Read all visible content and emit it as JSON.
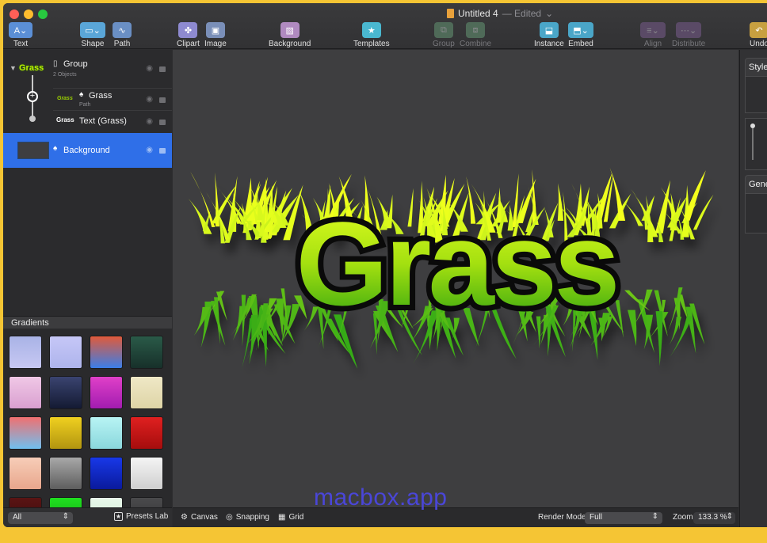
{
  "window": {
    "title": "Untitled 4",
    "status": "— Edited"
  },
  "toolbar": {
    "text": "Text",
    "shape": "Shape",
    "path": "Path",
    "clipart": "Clipart",
    "image": "Image",
    "background": "Background",
    "templates": "Templates",
    "group": "Group",
    "combine": "Combine",
    "instance": "Instance",
    "embed": "Embed",
    "align": "Align",
    "distribute": "Distribute",
    "undo": "Undo"
  },
  "layers": [
    {
      "name": "Group",
      "sub": "2 Objects",
      "thumb": "Grass"
    },
    {
      "name": "Grass",
      "sub": "Path",
      "thumb": "Grass"
    },
    {
      "name": "Text (Grass)",
      "thumb": "Grass"
    },
    {
      "name": "Background"
    }
  ],
  "gradients": {
    "title": "Gradients",
    "swatches": [
      [
        "#a9b3e6",
        "#c7c8f3"
      ],
      [
        "#c6c7f7",
        "#aeb4ec"
      ],
      [
        "#e05a3a",
        "#3b7ee8"
      ],
      [
        "#2a5a48",
        "#17302a"
      ],
      [
        "#f0c8e6",
        "#d99fd0"
      ],
      [
        "#3a4470",
        "#141a33"
      ],
      [
        "#e040c8",
        "#a21cb0"
      ],
      [
        "#efe8c6",
        "#ded4a6"
      ],
      [
        "#f07070",
        "#70c0f0"
      ],
      [
        "#f0d020",
        "#b29510"
      ],
      [
        "#b8f4f4",
        "#8ad7dc"
      ],
      [
        "#e02020",
        "#a50d0d"
      ],
      [
        "#f7cdb8",
        "#e8a68c"
      ],
      [
        "#a8a8a8",
        "#5e5e5e"
      ],
      [
        "#1838e8",
        "#0a1a9c"
      ],
      [
        "#f4f4f4",
        "#cfcfcf"
      ],
      [
        "#5a1414",
        "#3a0a0a"
      ],
      [
        "#20e020",
        "#12a012"
      ],
      [
        "#e8f8ea",
        "#cfe8d3"
      ],
      [
        "#4a4a4c",
        "#333335"
      ]
    ],
    "filter": "All",
    "presets": "Presets Lab"
  },
  "bottom_bar": {
    "canvas": "Canvas",
    "snapping": "Snapping",
    "grid": "Grid",
    "render_label": "Render Mode",
    "render_value": "Full",
    "zoom_label": "Zoom",
    "zoom_value": "133.3 %"
  },
  "canvas": {
    "art_text": "Grass"
  },
  "inspector": {
    "style": "Style",
    "general": "Gene"
  },
  "watermark": "macbox.app"
}
